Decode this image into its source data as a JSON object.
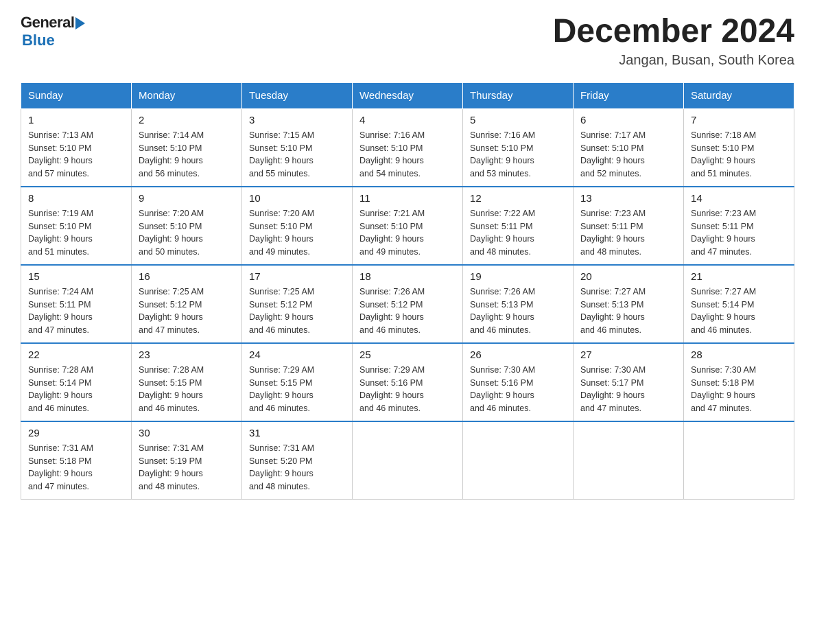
{
  "header": {
    "logo_general": "General",
    "logo_blue": "Blue",
    "month_title": "December 2024",
    "location": "Jangan, Busan, South Korea"
  },
  "days_of_week": [
    "Sunday",
    "Monday",
    "Tuesday",
    "Wednesday",
    "Thursday",
    "Friday",
    "Saturday"
  ],
  "weeks": [
    [
      {
        "day": "1",
        "sunrise": "7:13 AM",
        "sunset": "5:10 PM",
        "daylight": "9 hours and 57 minutes."
      },
      {
        "day": "2",
        "sunrise": "7:14 AM",
        "sunset": "5:10 PM",
        "daylight": "9 hours and 56 minutes."
      },
      {
        "day": "3",
        "sunrise": "7:15 AM",
        "sunset": "5:10 PM",
        "daylight": "9 hours and 55 minutes."
      },
      {
        "day": "4",
        "sunrise": "7:16 AM",
        "sunset": "5:10 PM",
        "daylight": "9 hours and 54 minutes."
      },
      {
        "day": "5",
        "sunrise": "7:16 AM",
        "sunset": "5:10 PM",
        "daylight": "9 hours and 53 minutes."
      },
      {
        "day": "6",
        "sunrise": "7:17 AM",
        "sunset": "5:10 PM",
        "daylight": "9 hours and 52 minutes."
      },
      {
        "day": "7",
        "sunrise": "7:18 AM",
        "sunset": "5:10 PM",
        "daylight": "9 hours and 51 minutes."
      }
    ],
    [
      {
        "day": "8",
        "sunrise": "7:19 AM",
        "sunset": "5:10 PM",
        "daylight": "9 hours and 51 minutes."
      },
      {
        "day": "9",
        "sunrise": "7:20 AM",
        "sunset": "5:10 PM",
        "daylight": "9 hours and 50 minutes."
      },
      {
        "day": "10",
        "sunrise": "7:20 AM",
        "sunset": "5:10 PM",
        "daylight": "9 hours and 49 minutes."
      },
      {
        "day": "11",
        "sunrise": "7:21 AM",
        "sunset": "5:10 PM",
        "daylight": "9 hours and 49 minutes."
      },
      {
        "day": "12",
        "sunrise": "7:22 AM",
        "sunset": "5:11 PM",
        "daylight": "9 hours and 48 minutes."
      },
      {
        "day": "13",
        "sunrise": "7:23 AM",
        "sunset": "5:11 PM",
        "daylight": "9 hours and 48 minutes."
      },
      {
        "day": "14",
        "sunrise": "7:23 AM",
        "sunset": "5:11 PM",
        "daylight": "9 hours and 47 minutes."
      }
    ],
    [
      {
        "day": "15",
        "sunrise": "7:24 AM",
        "sunset": "5:11 PM",
        "daylight": "9 hours and 47 minutes."
      },
      {
        "day": "16",
        "sunrise": "7:25 AM",
        "sunset": "5:12 PM",
        "daylight": "9 hours and 47 minutes."
      },
      {
        "day": "17",
        "sunrise": "7:25 AM",
        "sunset": "5:12 PM",
        "daylight": "9 hours and 46 minutes."
      },
      {
        "day": "18",
        "sunrise": "7:26 AM",
        "sunset": "5:12 PM",
        "daylight": "9 hours and 46 minutes."
      },
      {
        "day": "19",
        "sunrise": "7:26 AM",
        "sunset": "5:13 PM",
        "daylight": "9 hours and 46 minutes."
      },
      {
        "day": "20",
        "sunrise": "7:27 AM",
        "sunset": "5:13 PM",
        "daylight": "9 hours and 46 minutes."
      },
      {
        "day": "21",
        "sunrise": "7:27 AM",
        "sunset": "5:14 PM",
        "daylight": "9 hours and 46 minutes."
      }
    ],
    [
      {
        "day": "22",
        "sunrise": "7:28 AM",
        "sunset": "5:14 PM",
        "daylight": "9 hours and 46 minutes."
      },
      {
        "day": "23",
        "sunrise": "7:28 AM",
        "sunset": "5:15 PM",
        "daylight": "9 hours and 46 minutes."
      },
      {
        "day": "24",
        "sunrise": "7:29 AM",
        "sunset": "5:15 PM",
        "daylight": "9 hours and 46 minutes."
      },
      {
        "day": "25",
        "sunrise": "7:29 AM",
        "sunset": "5:16 PM",
        "daylight": "9 hours and 46 minutes."
      },
      {
        "day": "26",
        "sunrise": "7:30 AM",
        "sunset": "5:16 PM",
        "daylight": "9 hours and 46 minutes."
      },
      {
        "day": "27",
        "sunrise": "7:30 AM",
        "sunset": "5:17 PM",
        "daylight": "9 hours and 47 minutes."
      },
      {
        "day": "28",
        "sunrise": "7:30 AM",
        "sunset": "5:18 PM",
        "daylight": "9 hours and 47 minutes."
      }
    ],
    [
      {
        "day": "29",
        "sunrise": "7:31 AM",
        "sunset": "5:18 PM",
        "daylight": "9 hours and 47 minutes."
      },
      {
        "day": "30",
        "sunrise": "7:31 AM",
        "sunset": "5:19 PM",
        "daylight": "9 hours and 48 minutes."
      },
      {
        "day": "31",
        "sunrise": "7:31 AM",
        "sunset": "5:20 PM",
        "daylight": "9 hours and 48 minutes."
      },
      null,
      null,
      null,
      null
    ]
  ],
  "labels": {
    "sunrise": "Sunrise:",
    "sunset": "Sunset:",
    "daylight": "Daylight:"
  }
}
